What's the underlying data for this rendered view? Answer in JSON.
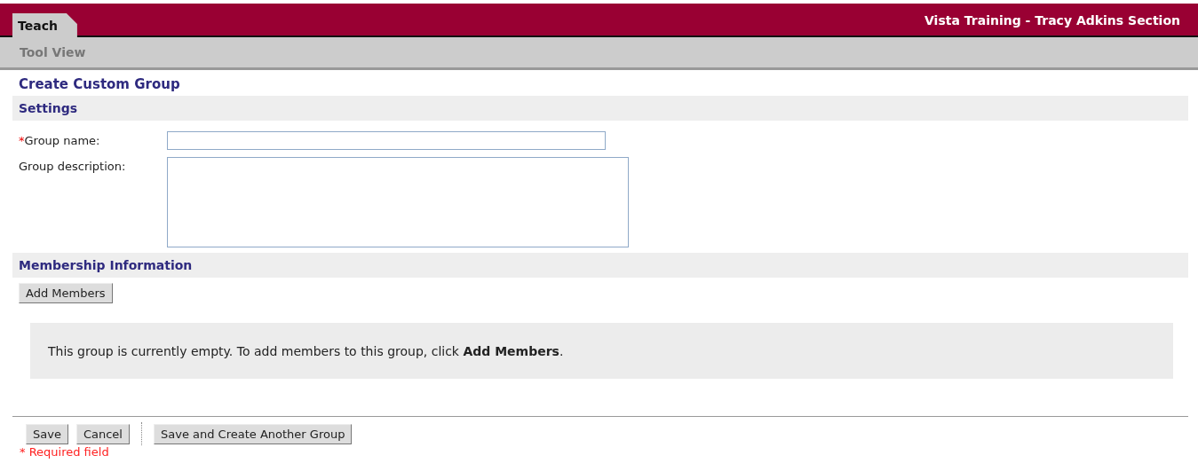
{
  "header": {
    "tab": {
      "label": "Teach",
      "selected": true
    },
    "section_title": "Vista Training - Tracy Adkins Section"
  },
  "subnav": {
    "label": "Tool View"
  },
  "page_title": "Create Custom Group",
  "settings": {
    "heading": "Settings",
    "fields": [
      {
        "kind": "input",
        "required_mark": "*",
        "label": "Group name:"
      },
      {
        "kind": "textarea",
        "label": "Group description:"
      }
    ]
  },
  "membership": {
    "heading": "Membership Information",
    "button": "Add Members",
    "message": "This group is currently empty. To add members to this group, click **Add Members**."
  },
  "actions": [
    {
      "label": "Save",
      "kind": "button"
    },
    {
      "label": "Cancel",
      "kind": "button"
    },
    {
      "kind": "separator"
    },
    {
      "label": "Save and Create Another Group",
      "kind": "button"
    }
  ],
  "required_note": "* Required field"
}
